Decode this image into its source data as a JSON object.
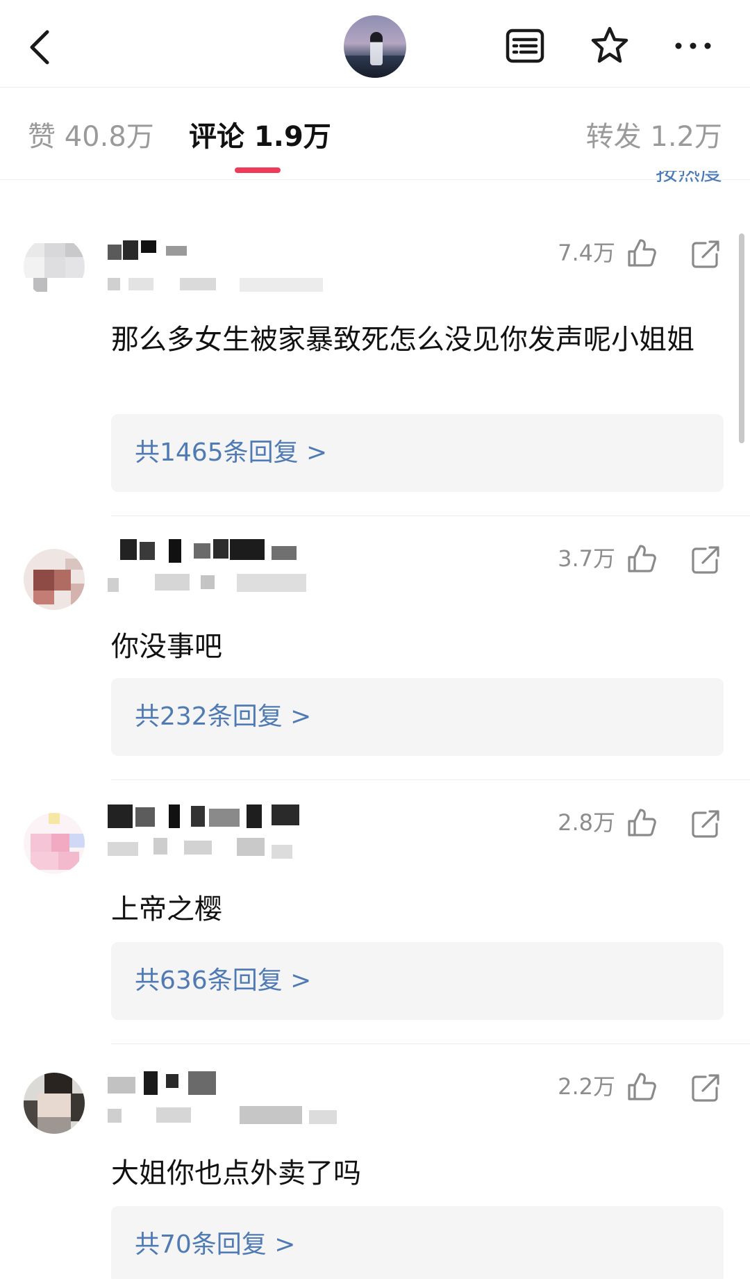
{
  "header": {
    "back_icon": "chevron-left-icon",
    "list_icon": "list-icon",
    "star_icon": "star-icon",
    "more_icon": "more-horizontal-icon"
  },
  "tabs": {
    "likes": "赞 40.8万",
    "comments": "评论 1.9万",
    "reposts": "转发 1.2万",
    "active_indicator_color": "#ef3b5a"
  },
  "sort_label": "按热度",
  "comments": [
    {
      "likes": "7.4万",
      "text": "那么多女生被家暴致死怎么没见你发声呢小姐姐",
      "replies": "共1465条回复 >"
    },
    {
      "likes": "3.7万",
      "text": "你没事吧",
      "replies": "共232条回复 >"
    },
    {
      "likes": "2.8万",
      "text": "上帝之樱",
      "replies": "共636条回复 >"
    },
    {
      "likes": "2.2万",
      "text": "大姐你也点外卖了吗",
      "replies": "共70条回复 >"
    }
  ],
  "colors": {
    "reply_link": "#4f7ab3",
    "muted": "#8d8d8d"
  }
}
